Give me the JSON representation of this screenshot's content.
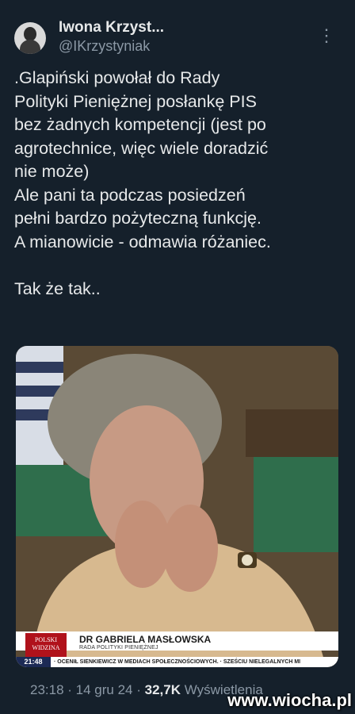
{
  "author": {
    "display_name": "Iwona Krzyst...",
    "handle": "@IKrzystyniak",
    "avatar_icon": "user-avatar"
  },
  "more_icon": "⋮",
  "tweet": {
    "text": ".Glapiński powołał do Rady\nPolityki Pieniężnej posłankę PIS\nbez żadnych kompetencji (jest po\nagrotechnice, więc wiele doradzić\nnie może)\nAle pani ta podczas posiedzeń\npełni bardzo pożyteczną funkcję.\nA mianowicie - odmawia różaniec.\n\nTak że tak.."
  },
  "media": {
    "channel_logo_text": "POLSKI WIDZINA",
    "person_name": "DR GABRIELA MASŁOWSKA",
    "person_role": "RADA POLITYKI PIENIĘŻNEJ",
    "time": "21:48",
    "news_ticker": "· OCENIŁ SIENKIEWICZ W MEDIACH SPOŁECZNOŚCIOWYCH.  · SZEŚCIU NIELEGALNYCH MI"
  },
  "meta": {
    "time": "23:18",
    "date": "14 gru 24",
    "views_count": "32,7K",
    "views_label": "Wyświetlenia"
  },
  "watermark": "www.wiocha.pl",
  "colors": {
    "background": "#15202b",
    "text": "#e7e9ea",
    "secondary_text": "#8b98a5"
  }
}
